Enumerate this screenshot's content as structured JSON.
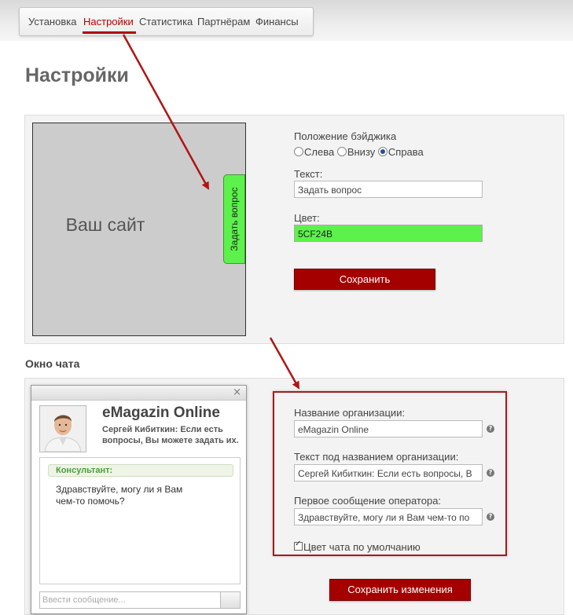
{
  "nav": {
    "items": [
      "Установка",
      "Настройки",
      "Статистика",
      "Партнёрам",
      "Финансы"
    ],
    "active_index": 1
  },
  "page_title": "Настройки",
  "badge_settings": {
    "preview_site_text": "Ваш сайт",
    "badge_text": "Задать вопрос",
    "position_label": "Положение бэйджика",
    "position_options": [
      "Слева",
      "Внизу",
      "Справа"
    ],
    "position_selected": "Справа",
    "text_label": "Текст:",
    "text_value": "Задать вопрос",
    "color_label": "Цвет:",
    "color_value": "5CF24B",
    "save_label": "Сохранить"
  },
  "chat_section": {
    "title": "Окно чата",
    "window": {
      "close_glyph": "×",
      "org_name": "eMagazin Online",
      "org_subtitle": "Сергей Кибиткин: Если есть вопросы, Вы можете задать их.",
      "consultant_label": "Консультант:",
      "message": "Здравствуйте, могу ли я Вам чем-то помочь?",
      "input_placeholder": "Ввести сообщение..."
    },
    "form": {
      "org_name_label": "Название организации:",
      "org_name_value": "eMagazin Online",
      "subtitle_label": "Текст под названием организации:",
      "subtitle_value": "Сергей Кибиткин: Если есть вопросы, В",
      "first_message_label": "Первое сообщение оператора:",
      "first_message_value": "Здравствуйте, могу ли я Вам чем-то по",
      "default_color_label": "Цвет чата по умолчанию",
      "default_color_checked": true,
      "save_label": "Сохранить изменения"
    }
  },
  "colors": {
    "accent_red": "#a50000",
    "badge_green": "#5CF24B",
    "consultant_green": "#4f9b3b"
  }
}
